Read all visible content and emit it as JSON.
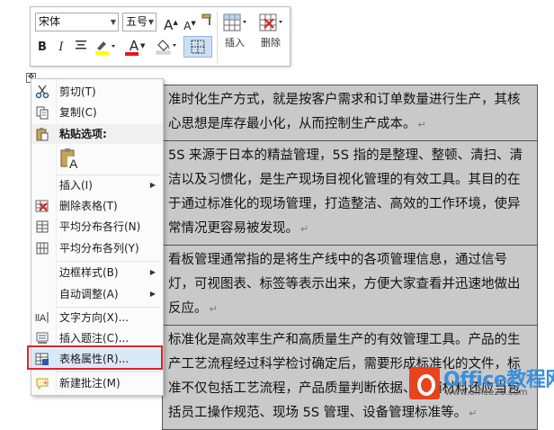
{
  "mini_toolbar": {
    "font_name": "宋体",
    "font_size": "五号",
    "grow_font": "A",
    "shrink_font": "A",
    "bold": "B",
    "italic": "I",
    "font_color": "A",
    "insert_label": "插入",
    "delete_label": "删除"
  },
  "context_menu": {
    "items": [
      {
        "label": "剪切(T)",
        "icon": "scissors-icon"
      },
      {
        "label": "复制(C)",
        "icon": "copy-icon"
      },
      {
        "label": "粘贴选项:",
        "icon": "paste-icon"
      },
      {
        "label": "插入(I)",
        "icon": ""
      },
      {
        "label": "删除表格(T)",
        "icon": "delete-table-icon"
      },
      {
        "label": "平均分布各行(N)",
        "icon": "distribute-rows-icon"
      },
      {
        "label": "平均分布各列(Y)",
        "icon": "distribute-columns-icon"
      },
      {
        "label": "边框样式(B)",
        "icon": ""
      },
      {
        "label": "自动调整(A)",
        "icon": ""
      },
      {
        "label": "文字方向(X)...",
        "icon": "text-direction-icon"
      },
      {
        "label": "插入题注(C)...",
        "icon": "insert-caption-icon"
      },
      {
        "label": "表格属性(R)...",
        "icon": "table-properties-icon"
      },
      {
        "label": "新建批注(M)",
        "icon": "new-comment-icon"
      }
    ],
    "highlight_color": "#e0242b"
  },
  "document": {
    "rows": [
      "准时化生产方式，就是按客户需求和订单数量进行生产，其核心思想是库存最小化，从而控制生产成本。",
      "5S 来源于日本的精益管理，5S 指的是整理、整顿、清扫、清洁以及习惯化，是生产现场目视化管理的有效工具。其目的在于通过标准化的现场管理，打造整洁、高效的工作环境，使异常情况更容易被发现。",
      "看板管理通常指的是将生产线中的各项管理信息，通过信号灯，可视图表、标签等表示出来，方便大家查看并迅速地做出反应。",
      "标准化是高效率生产和高质量生产的有效管理工具。产品的生产工艺流程经过科学检讨确定后，需要形成标准化的文件，标准不仅包括工艺流程，产品质量判断依据、原辅材料还应当包括员工操作规范、现场 5S 管理、设备管理标准等。"
    ],
    "para_mark": "↵",
    "cell_shading": "#c9c9c9"
  },
  "watermark": {
    "title": "Office教程网",
    "url": "www.office26.com"
  }
}
